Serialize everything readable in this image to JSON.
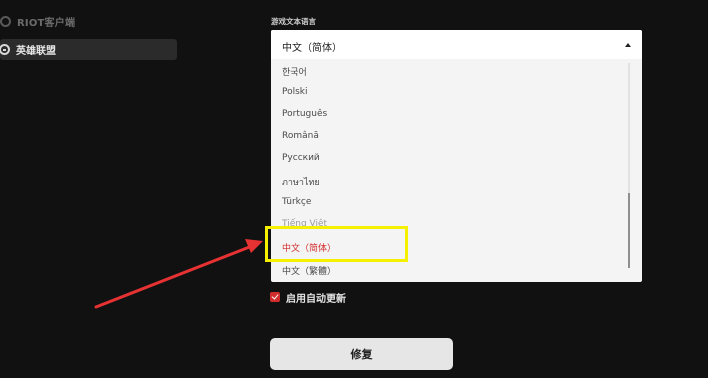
{
  "sidebar": {
    "header_label": "RIOT客户端",
    "header_icon": "riot-logo-icon",
    "items": [
      {
        "label": "英雄联盟",
        "icon": "league-logo-icon"
      }
    ]
  },
  "settings": {
    "language_section_label": "游戏文本语言",
    "language_dropdown": {
      "selected_value": "中文（简体）",
      "caret_icon": "chevron-up-icon",
      "options": [
        {
          "label": "한국어"
        },
        {
          "label": "Polski"
        },
        {
          "label": "Português"
        },
        {
          "label": "Română"
        },
        {
          "label": "Русский"
        },
        {
          "label": "ภาษาไทย"
        },
        {
          "label": "Türkçe"
        },
        {
          "label": "Tiếng Việt"
        },
        {
          "label": "中文（简体）"
        },
        {
          "label": "中文（繁體）"
        }
      ],
      "selected_index": 8,
      "selected_color": "#d22d2d"
    },
    "auto_update_label": "启用自动更新",
    "auto_update_checked": true,
    "repair_button_label": "修复"
  },
  "annotation": {
    "highlight_color": "#f4f000",
    "arrow_color": "#e63232"
  }
}
